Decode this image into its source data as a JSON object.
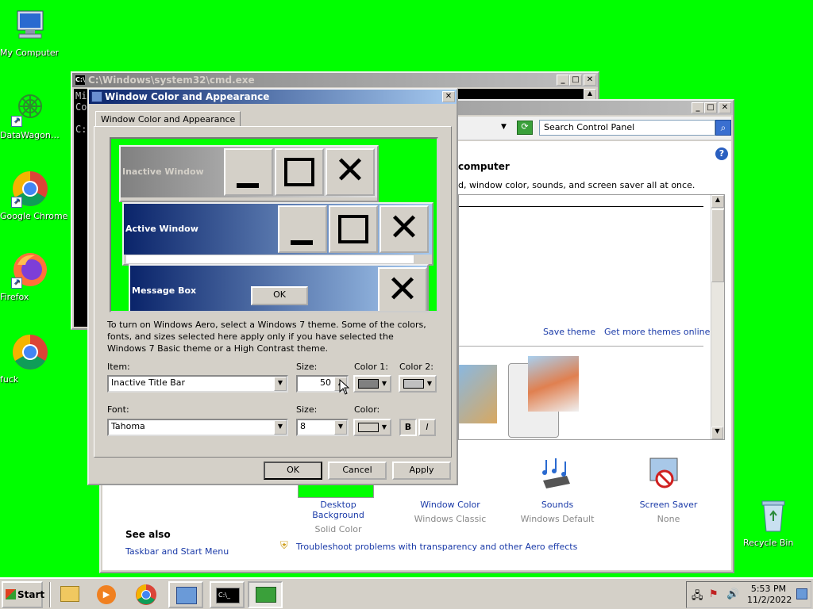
{
  "desktop": {
    "icons": [
      {
        "label": "My Computer",
        "icon": "my-computer-icon"
      },
      {
        "label": "DataWagon…",
        "icon": "datawagon-icon"
      },
      {
        "label": "Google Chrome",
        "icon": "chrome-icon"
      },
      {
        "label": "Firefox",
        "icon": "firefox-icon"
      },
      {
        "label": "fuck",
        "icon": "chrome-icon"
      },
      {
        "label": "Recycle Bin",
        "icon": "recycle-bin-icon"
      }
    ]
  },
  "cmd": {
    "title": "C:\\Windows\\system32\\cmd.exe",
    "lines": [
      "Mi",
      "Co",
      "",
      "C:"
    ]
  },
  "control_panel": {
    "search_placeholder": "Search Control Panel",
    "heading_fragment": "computer",
    "desc_fragment": "d, window color, sounds, and screen saver all at once.",
    "save_theme": "Save theme",
    "get_more_themes": "Get more themes online",
    "items": [
      {
        "label": "Desktop Background",
        "sub": "Solid Color"
      },
      {
        "label": "Window Color",
        "sub": "Windows Classic"
      },
      {
        "label": "Sounds",
        "sub": "Windows Default"
      },
      {
        "label": "Screen Saver",
        "sub": "None"
      }
    ],
    "see_also": "See also",
    "taskbar_link": "Taskbar and Start Menu",
    "troubleshoot_link": "Troubleshoot problems with transparency and other Aero effects"
  },
  "dialog": {
    "title": "Window Color and Appearance",
    "tab": "Window Color and Appearance",
    "preview": {
      "inactive": "Inactive Window",
      "active": "Active Window",
      "message_box": "Message Box",
      "ok": "OK"
    },
    "info": "To turn on Windows Aero, select a Windows 7 theme.  Some of the colors, fonts, and sizes selected here apply only if you have selected the Windows 7 Basic theme or a High Contrast theme.",
    "item_label": "Item:",
    "item_value": "Inactive Title Bar",
    "size_label": "Size:",
    "size_value": "50",
    "color1_label": "Color 1:",
    "color2_label": "Color 2:",
    "font_label": "Font:",
    "font_value": "Tahoma",
    "font_size_label": "Size:",
    "font_size_value": "8",
    "color_label": "Color:",
    "bold": "B",
    "italic": "I",
    "ok": "OK",
    "cancel": "Cancel",
    "apply": "Apply"
  },
  "taskbar": {
    "start": "Start",
    "time": "5:53 PM",
    "date": "11/2/2022"
  },
  "colors": {
    "desktop": "#00ff00",
    "active_title_start": "#0a246a",
    "active_title_end": "#a6caf0",
    "inactive_title_start": "#808080",
    "inactive_title_end": "#c0c0c0"
  }
}
